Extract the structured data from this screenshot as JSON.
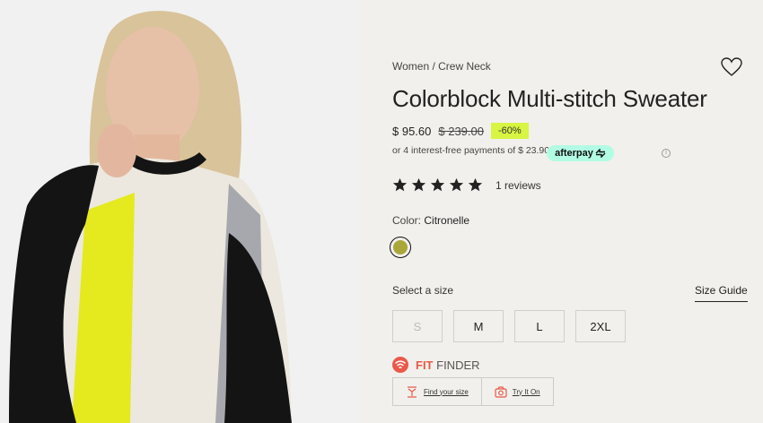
{
  "product": {
    "breadcrumb": "Women / Crew Neck",
    "title": "Colorblock Multi-stitch Sweater",
    "price_current": "$ 95.60",
    "price_original": "$ 239.00",
    "discount": "-60%",
    "installments_text": "or 4 interest-free payments of $ 23.90 with",
    "afterpay_label": "afterpay",
    "info_icon": "i",
    "reviews": {
      "rating": 5,
      "count_label": "1 reviews"
    },
    "color": {
      "label": "Color:",
      "value": "Citronelle",
      "swatch_hex": "#a9a73a"
    },
    "size": {
      "label": "Select a size",
      "guide_label": "Size Guide",
      "options": [
        {
          "label": "S",
          "available": false
        },
        {
          "label": "M",
          "available": true
        },
        {
          "label": "L",
          "available": true
        },
        {
          "label": "2XL",
          "available": true
        }
      ]
    },
    "fit_finder": {
      "fit": "FIT",
      "finder": "FINDER",
      "find_size_label": "Find your size",
      "try_on_label": "Try It On"
    }
  },
  "colors": {
    "accent_discount": "#d7f542",
    "afterpay": "#b2fce4",
    "fitfinder": "#e8594a"
  }
}
